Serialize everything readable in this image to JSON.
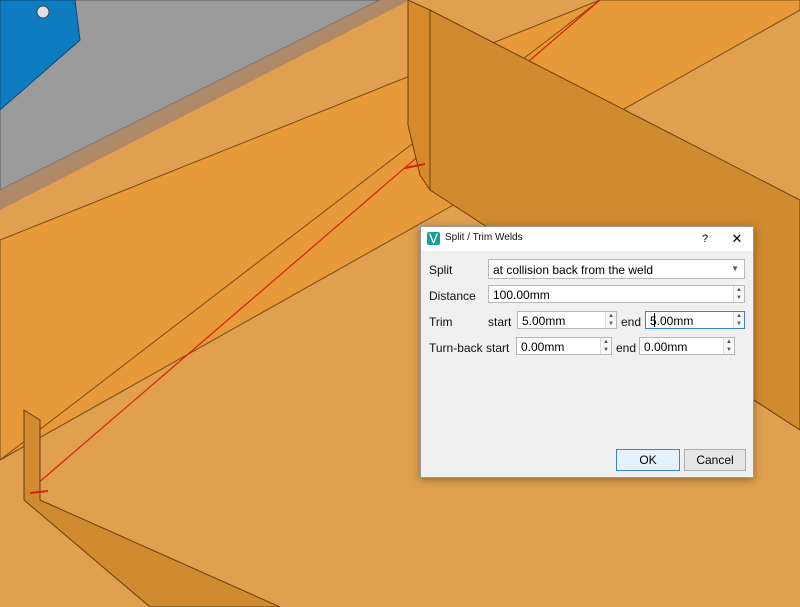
{
  "dialog": {
    "title": "Split / Trim Welds",
    "help_label": "?",
    "close_label": "✕",
    "split": {
      "label": "Split",
      "value": "at collision back from the weld"
    },
    "distance": {
      "label": "Distance",
      "value": "100.00mm"
    },
    "trim": {
      "label": "Trim",
      "start_label": "start",
      "start_value": "5.00mm",
      "end_label": "end",
      "end_value": "5.00mm"
    },
    "turnback": {
      "label": "Turn-back",
      "start_label": "start",
      "start_value": "0.00mm",
      "end_label": "end",
      "end_value": "0.00mm"
    },
    "ok_label": "OK",
    "cancel_label": "Cancel"
  },
  "colors": {
    "orange_floor": "#e0a050",
    "orange_wall": "#d98f30",
    "gray_plate": "#9b9b9b",
    "blue_part": "#0e7cc0",
    "weld_line": "#d62010",
    "accent": "#3b7ed6"
  }
}
